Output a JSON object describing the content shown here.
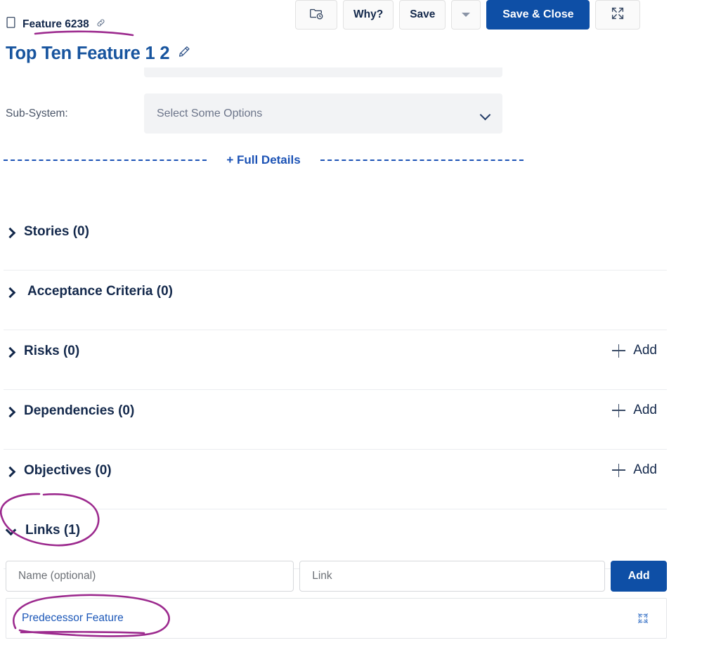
{
  "toolbar": {
    "history_icon": "folder-clock-icon",
    "why_label": "Why?",
    "save_label": "Save",
    "save_dropdown_icon": "caret-down-icon",
    "save_close_label": "Save & Close",
    "expand_icon": "expand-icon",
    "primary_color": "#0e4fa6"
  },
  "header": {
    "type_icon": "document-icon",
    "breadcrumb": "Feature 6238",
    "link_icon": "chain-link-icon",
    "title": "Top Ten Feature 1 2",
    "edit_icon": "pencil-icon",
    "title_color": "#17549e"
  },
  "form": {
    "subsystem_label": "Sub-System:",
    "subsystem_placeholder": "Select Some Options",
    "subsystem_caret_icon": "chevron-down-icon"
  },
  "full_details": {
    "label": "+ Full Details",
    "color": "#1b52b5"
  },
  "sections": [
    {
      "title": "Stories (0)",
      "expanded": false,
      "has_add": false,
      "indent": false
    },
    {
      "title": "Acceptance Criteria (0)",
      "expanded": false,
      "has_add": false,
      "indent": true
    },
    {
      "title": "Risks (0)",
      "expanded": false,
      "has_add": true,
      "indent": false
    },
    {
      "title": "Dependencies (0)",
      "expanded": false,
      "has_add": true,
      "indent": false
    },
    {
      "title": "Objectives (0)",
      "expanded": false,
      "has_add": true,
      "indent": false
    },
    {
      "title": "Links (1)",
      "expanded": true,
      "has_add": false,
      "indent": false
    }
  ],
  "add_label": "Add",
  "links": {
    "name_placeholder": "Name (optional)",
    "url_placeholder": "Link",
    "name_value": "",
    "url_value": "",
    "add_button_label": "Add",
    "rows": [
      {
        "name": "Predecessor Feature",
        "unlink_icon": "unlink-icon"
      }
    ]
  },
  "annotations": {
    "color": "#9c2a8e",
    "marks": [
      "underline-under-breadcrumb",
      "circle-around-links-section",
      "circle-around-predecessor-feature"
    ]
  }
}
